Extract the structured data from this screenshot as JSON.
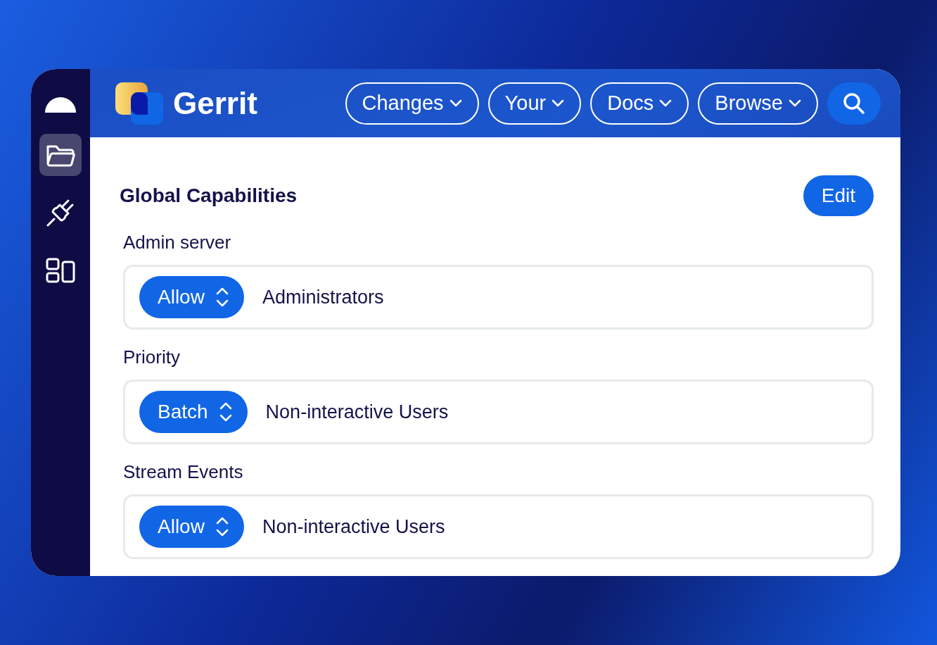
{
  "sidebar": {
    "items": [
      {
        "kind": "dome",
        "selected": false
      },
      {
        "kind": "folder",
        "selected": true
      },
      {
        "kind": "plug",
        "selected": false
      },
      {
        "kind": "widgets",
        "selected": false
      }
    ]
  },
  "header": {
    "brand": "Gerrit",
    "nav": [
      {
        "label": "Changes"
      },
      {
        "label": "Your"
      },
      {
        "label": "Docs"
      },
      {
        "label": "Browse"
      }
    ]
  },
  "page": {
    "title": "Global Capabilities",
    "edit_button": "Edit",
    "capabilities": [
      {
        "name": "Admin server",
        "action": "Allow",
        "group": "Administrators"
      },
      {
        "name": "Priority",
        "action": "Batch",
        "group": "Non-interactive Users"
      },
      {
        "name": "Stream Events",
        "action": "Allow",
        "group": "Non-interactive Users"
      }
    ]
  }
}
